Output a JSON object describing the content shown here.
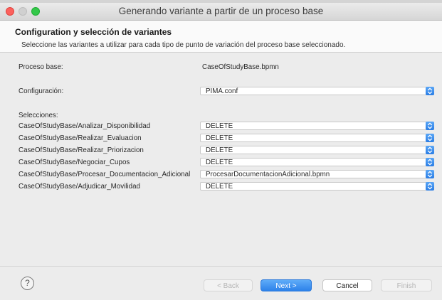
{
  "window": {
    "title": "Generando variante a partir de un proceso base"
  },
  "header": {
    "title": "Configuration y selección de variantes",
    "description": "Seleccione las variantes a utilizar para cada tipo de punto de variación del proceso base seleccionado."
  },
  "form": {
    "base_label": "Proceso base:",
    "base_value": "CaseOfStudyBase.bpmn",
    "config_label": "Configuración:",
    "config_value": "PIMA.conf",
    "selections_label": "Selecciones:",
    "selections": [
      {
        "label": "CaseOfStudyBase/Analizar_Disponibilidad",
        "value": "DELETE"
      },
      {
        "label": "CaseOfStudyBase/Realizar_Evaluacion",
        "value": "DELETE"
      },
      {
        "label": "CaseOfStudyBase/Realizar_Priorizacion",
        "value": "DELETE"
      },
      {
        "label": "CaseOfStudyBase/Negociar_Cupos",
        "value": "DELETE"
      },
      {
        "label": "CaseOfStudyBase/Procesar_Documentacion_Adicional",
        "value": "ProcesarDocumentacionAdicional.bpmn"
      },
      {
        "label": "CaseOfStudyBase/Adjudicar_Movilidad",
        "value": "DELETE"
      }
    ]
  },
  "footer": {
    "help_symbol": "?",
    "back_label": "< Back",
    "next_label": "Next >",
    "cancel_label": "Cancel",
    "finish_label": "Finish"
  },
  "icons": {
    "combo_arrow": "chevron-up-down-icon",
    "help": "help-icon"
  },
  "colors": {
    "accent": "#2d82ea",
    "close": "#fc615d",
    "maximize": "#34c84a"
  }
}
